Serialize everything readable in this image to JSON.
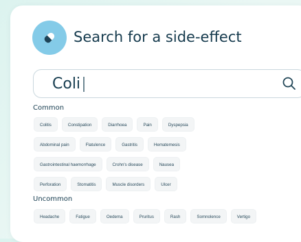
{
  "header": {
    "title": "Search for a side-effect",
    "icon": "pill-icon"
  },
  "search": {
    "value": "Coli",
    "icon": "search-icon"
  },
  "sections": {
    "common_label": "Common",
    "uncommon_label": "Uncommon"
  },
  "common": {
    "row1": [
      "Colitis",
      "Constipation",
      "Diarrhoea",
      "Pain",
      "Dyspepsia"
    ],
    "row2": [
      "Abdominal pain",
      "Flatulence",
      "Gastritis",
      "Hematemesis"
    ],
    "row3": [
      "Gastrointestinal haemorrhage",
      "Crohn's disease",
      "Nausea"
    ],
    "row4": [
      "Perforation",
      "Stomatitis",
      "Muscle disorders",
      "Ulcer"
    ]
  },
  "uncommon": {
    "row1": [
      "Headache",
      "Fatigue",
      "Oedema",
      "Pruritus",
      "Rash",
      "Somnolence",
      "Vertigo"
    ]
  },
  "colors": {
    "title": "#153a4d",
    "accent": "#84cbe8",
    "chip_bg": "#f3f5f6"
  }
}
